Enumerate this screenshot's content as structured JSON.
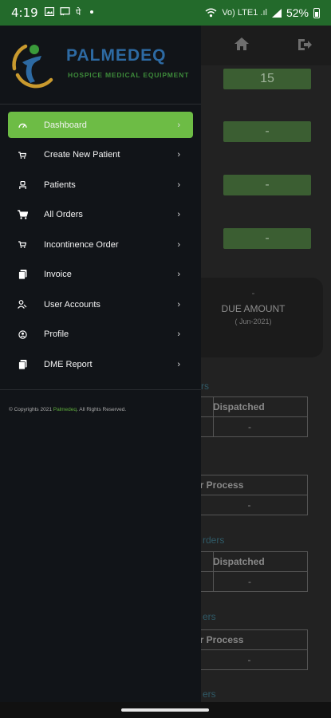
{
  "status_bar": {
    "time": "4:19",
    "left_icons": [
      "image-icon",
      "cast-icon",
      "notification-icon",
      "dot-icon"
    ],
    "network_label": "Vo) LTE1 .ıl",
    "battery": "52%"
  },
  "brand": {
    "title": "PALMEDEQ",
    "subtitle": "HOSPICE MEDICAL EQUIPMENT"
  },
  "menu": [
    {
      "label": "Dashboard",
      "icon": "dashboard-icon",
      "active": true
    },
    {
      "label": "Create New Patient",
      "icon": "cart-icon",
      "active": false
    },
    {
      "label": "Patients",
      "icon": "person-icon",
      "active": false
    },
    {
      "label": "All Orders",
      "icon": "shopping-cart-icon",
      "active": false
    },
    {
      "label": "Incontinence Order",
      "icon": "cart-icon",
      "active": false
    },
    {
      "label": "Invoice",
      "icon": "document-icon",
      "active": false
    },
    {
      "label": "User Accounts",
      "icon": "users-icon",
      "active": false
    },
    {
      "label": "Profile",
      "icon": "profile-icon",
      "active": false
    },
    {
      "label": "DME Report",
      "icon": "document-icon",
      "active": false
    }
  ],
  "chevron": "›",
  "copyright": {
    "prefix": "© Copyrights 2021 ",
    "brand": "Palmedeq",
    "suffix": ". All Rights Reserved."
  },
  "background": {
    "stat_values": [
      "15",
      "-",
      "-",
      "-"
    ],
    "due_card": {
      "value": "-",
      "label": "DUE AMOUNT",
      "period": "( Jun-2021)"
    },
    "table_headers": [
      "Dispatched",
      "er Process",
      "Dispatched",
      "er Process"
    ],
    "table_values": [
      "-",
      "-",
      "-",
      "-"
    ],
    "section_labels": [
      "rs",
      "rders",
      "ers",
      "ers"
    ]
  },
  "colors": {
    "accent": "#6dbc45",
    "status_bar": "#236a2b",
    "drawer_bg": "#111418",
    "brand_blue": "#2d6aa3",
    "brand_green": "#3d8a3a"
  }
}
